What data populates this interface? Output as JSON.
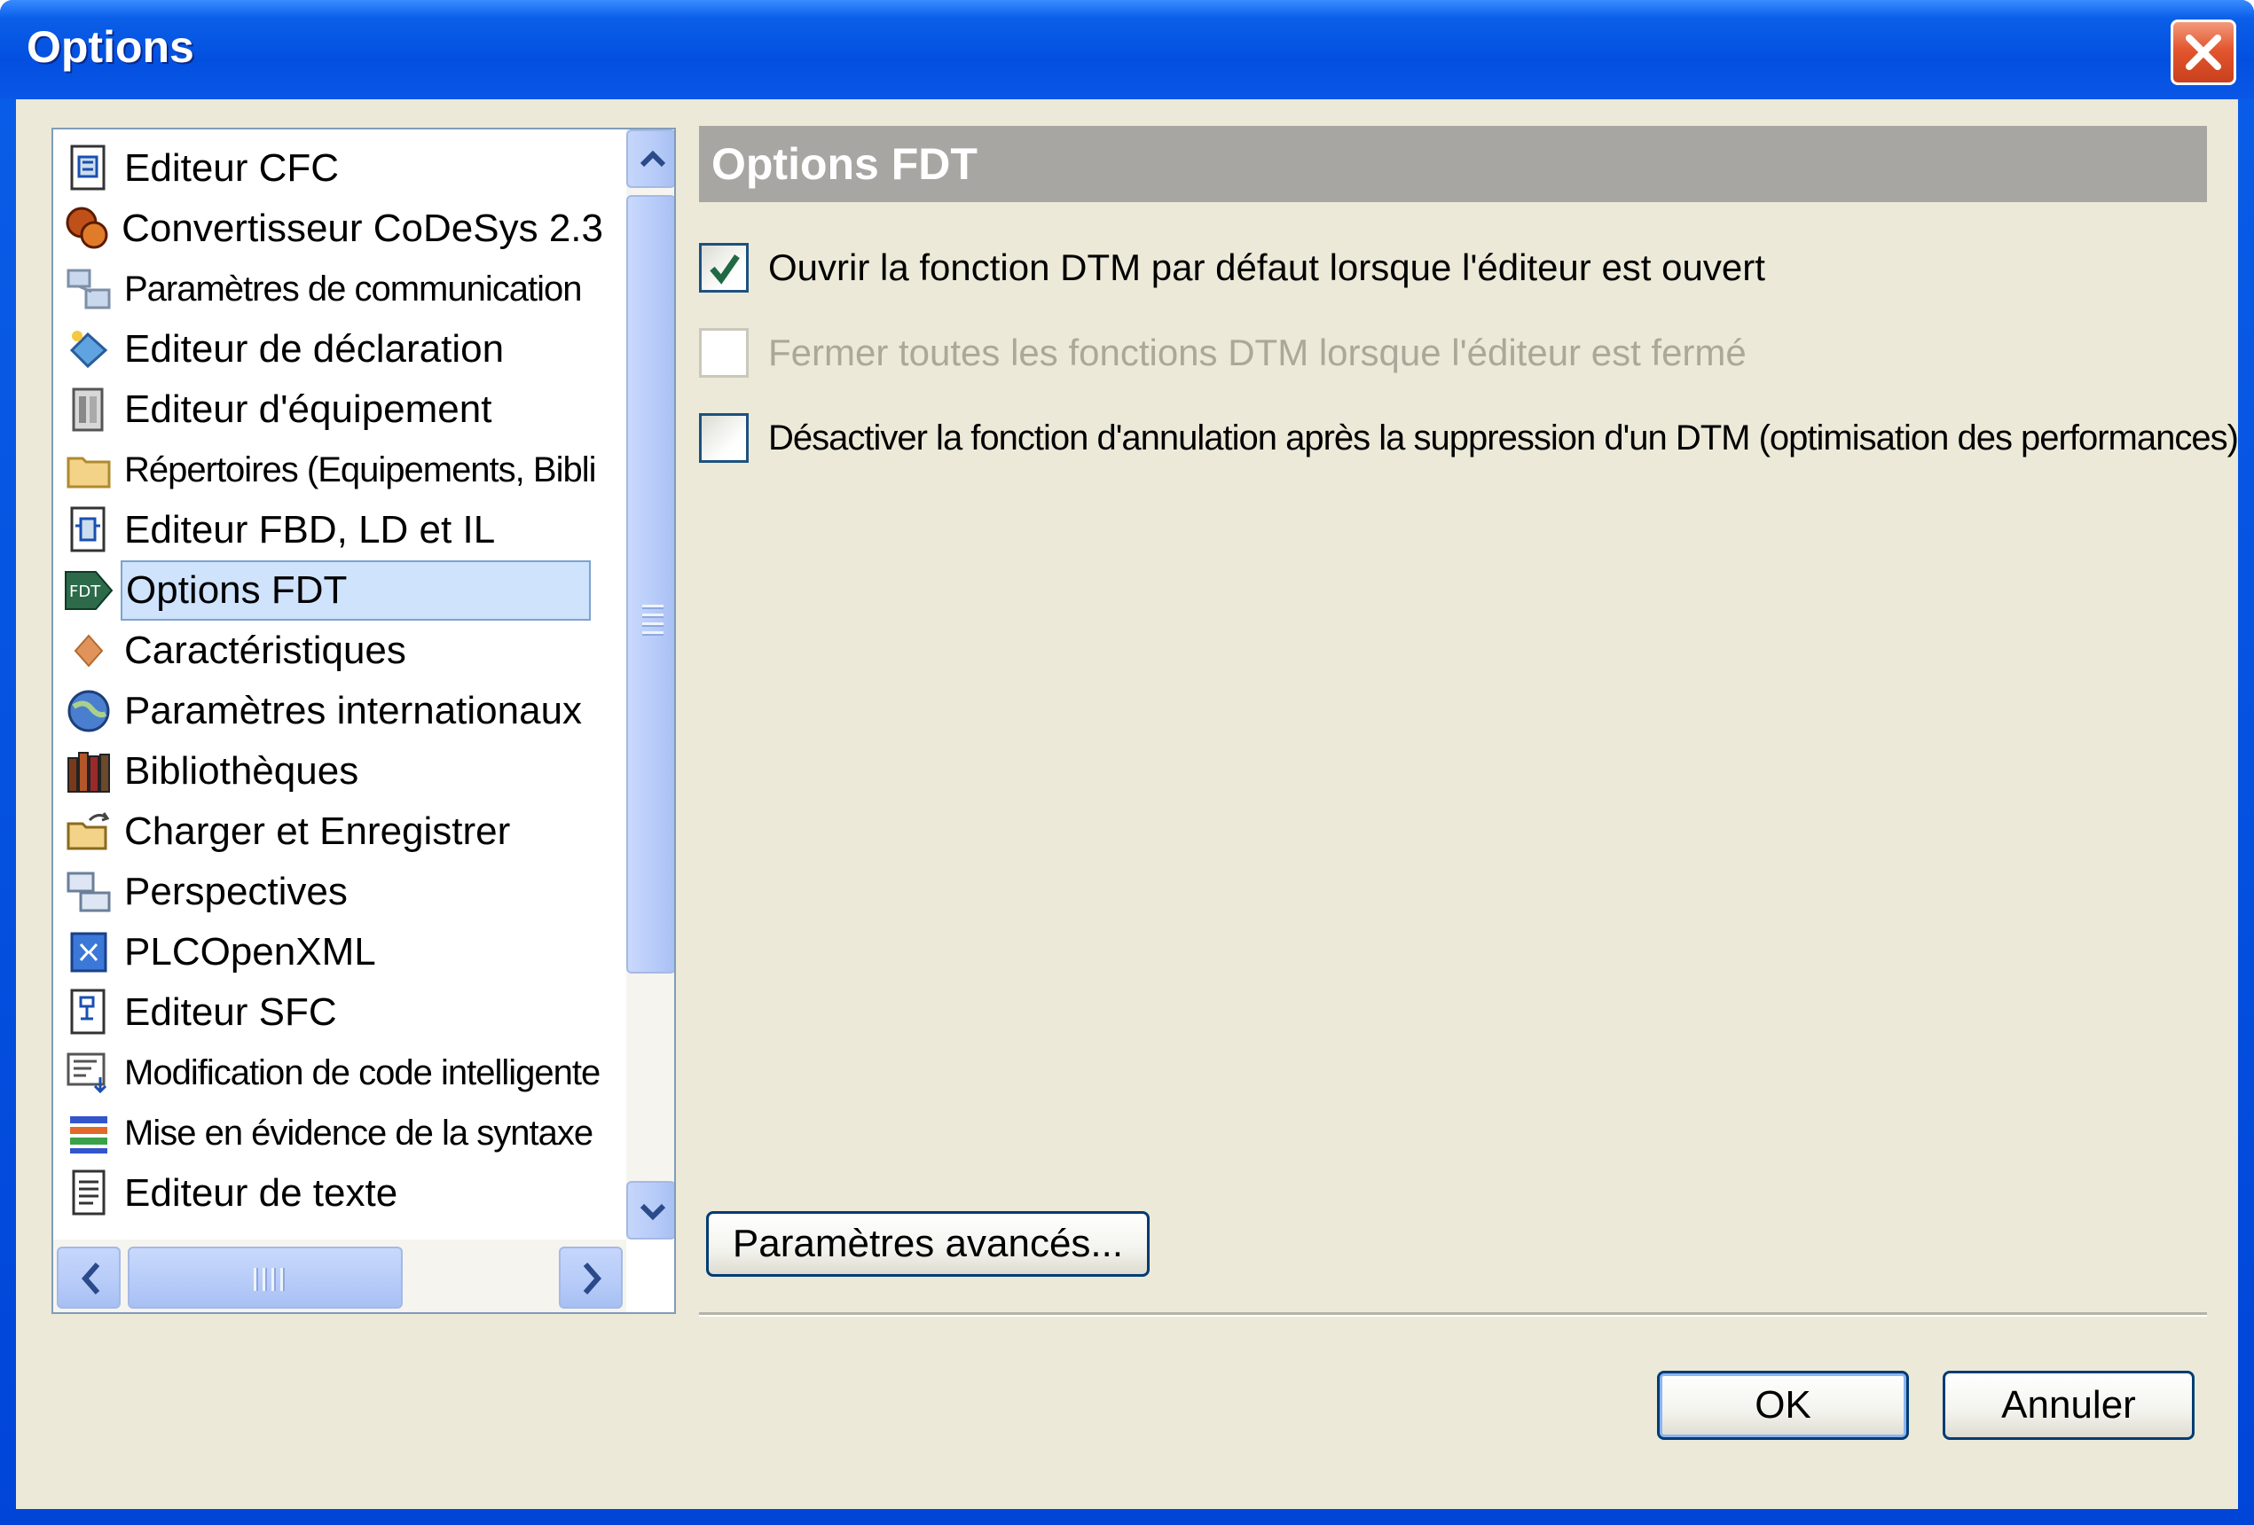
{
  "window": {
    "title": "Options",
    "close_icon": "close-icon"
  },
  "categories": [
    {
      "label": "Editeur CFC",
      "icon": "cfc-editor-icon"
    },
    {
      "label": "Convertisseur CoDeSys 2.3",
      "icon": "converter-icon"
    },
    {
      "label": "Paramètres de communication",
      "icon": "communication-icon"
    },
    {
      "label": "Editeur de déclaration",
      "icon": "declaration-editor-icon"
    },
    {
      "label": "Editeur d'équipement",
      "icon": "device-editor-icon"
    },
    {
      "label": "Répertoires (Equipements, Bibli",
      "icon": "folder-icon"
    },
    {
      "label": "Editeur FBD, LD et IL",
      "icon": "fbd-editor-icon"
    },
    {
      "label": "Options FDT",
      "icon": "fdt-icon"
    },
    {
      "label": "Caractéristiques",
      "icon": "features-icon"
    },
    {
      "label": "Paramètres internationaux",
      "icon": "globe-icon"
    },
    {
      "label": "Bibliothèques",
      "icon": "library-icon"
    },
    {
      "label": "Charger et Enregistrer",
      "icon": "load-save-icon"
    },
    {
      "label": "Perspectives",
      "icon": "perspectives-icon"
    },
    {
      "label": "PLCOpenXML",
      "icon": "plcopenxml-icon"
    },
    {
      "label": "Editeur SFC",
      "icon": "sfc-editor-icon"
    },
    {
      "label": "Modification de code intelligente",
      "icon": "smart-coding-icon"
    },
    {
      "label": "Mise en évidence de la syntaxe",
      "icon": "syntax-highlight-icon"
    },
    {
      "label": "Editeur de texte",
      "icon": "text-editor-icon"
    }
  ],
  "selected_category": "Options FDT",
  "panel": {
    "title": "Options FDT",
    "options": [
      {
        "label": "Ouvrir la fonction DTM par défaut lorsque l'éditeur est ouvert",
        "checked": true,
        "enabled": true
      },
      {
        "label": "Fermer toutes les fonctions DTM lorsque l'éditeur est fermé",
        "checked": false,
        "enabled": false
      },
      {
        "label": "Désactiver la fonction d'annulation après la suppression d'un DTM (optimisation des performances)",
        "checked": false,
        "enabled": true
      }
    ],
    "advanced_button": "Paramètres avancés..."
  },
  "footer": {
    "ok_label": "OK",
    "cancel_label": "Annuler"
  },
  "colors": {
    "title_bar": "#0350e0",
    "dialog_bg": "#ece9d8",
    "selection": "#cfe3fc",
    "section_header": "#a7a6a2"
  }
}
